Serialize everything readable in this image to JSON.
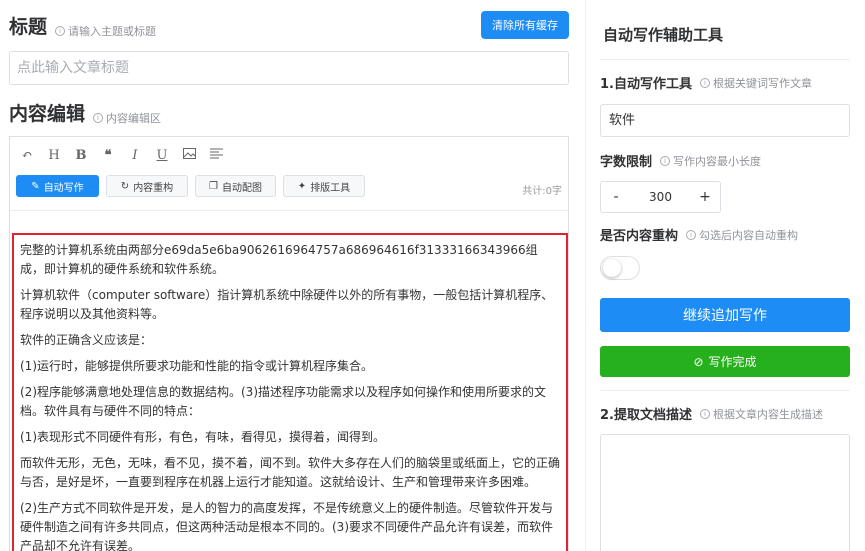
{
  "editor": {
    "title_heading": "标题",
    "title_hint": "请输入主题或标题",
    "clear_cache_label": "清除所有缓存",
    "title_placeholder": "点此输入文章标题",
    "content_heading": "内容编辑",
    "content_hint": "内容编辑区",
    "toolbar_icons": [
      "undo-icon",
      "heading-icon",
      "bold-icon",
      "quote-icon",
      "italic-icon",
      "underline-icon",
      "image-icon",
      "align-icon"
    ],
    "tools": [
      {
        "label": "自动写作",
        "icon": "pen-icon"
      },
      {
        "label": "内容重构",
        "icon": "refresh-icon"
      },
      {
        "label": "自动配图",
        "icon": "gallery-icon"
      },
      {
        "label": "排版工具",
        "icon": "magic-icon"
      }
    ],
    "word_count": "共计:0字",
    "paragraphs": [
      "完整的计算机系统由两部分e69da5e6ba9062616964757a686964616f31333166343966组成，即计算机的硬件系统和软件系统。",
      "计算机软件（computer software）指计算机系统中除硬件以外的所有事物，一般包括计算机程序、程序说明以及其他资料等。",
      "软件的正确含义应该是：",
      "(1)运行时，能够提供所要求功能和性能的指令或计算机程序集合。",
      "(2)程序能够满意地处理信息的数据结构。(3)描述程序功能需求以及程序如何操作和使用所要求的文档。软件具有与硬件不同的特点：",
      "(1)表现形式不同硬件有形，有色，有味，看得见，摸得着，闻得到。",
      "而软件无形，无色，无味，看不见，摸不着，闻不到。软件大多存在人们的脑袋里或纸面上，它的正确与否，是好是坏，一直要到程序在机器上运行才能知道。这就给设计、生产和管理带来许多困难。",
      "(2)生产方式不同软件是开发，是人的智力的高度发挥，不是传统意义上的硬件制造。尽管软件开发与硬件制造之间有许多共同点，但这两种活动是根本不同的。(3)要求不同硬件产品允许有误差，而软件产品却不允许有误差。"
    ]
  },
  "sidebar": {
    "heading": "自动写作辅助工具",
    "tool1_label": "1.自动写作工具",
    "tool1_hint": "根据关键词写作文章",
    "keyword_value": "软件",
    "word_limit_label": "字数限制",
    "word_limit_hint": "写作内容最小长度",
    "stepper_minus": "-",
    "stepper_value": "300",
    "stepper_plus": "+",
    "restructure_label": "是否内容重构",
    "restructure_hint": "勾选后内容自动重构",
    "restructure_enabled": false,
    "continue_label": "继续追加写作",
    "done_label": "写作完成",
    "tool2_label": "2.提取文档描述",
    "tool2_hint": "根据文章内容生成描述"
  },
  "colors": {
    "primary": "#1e8cf5",
    "success": "#27b01e",
    "highlight_border": "#e0232f"
  }
}
